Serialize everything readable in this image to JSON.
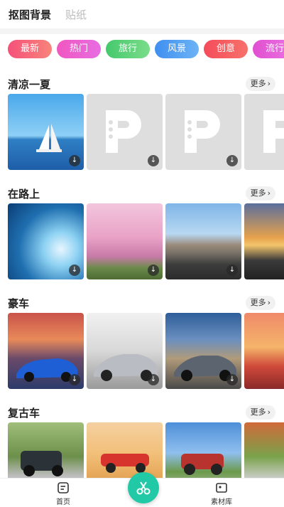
{
  "header": {
    "tabs": [
      {
        "label": "抠图背景",
        "active": true
      },
      {
        "label": "贴纸",
        "active": false
      }
    ]
  },
  "categories": [
    {
      "label": "最新",
      "color": "#f2657c"
    },
    {
      "label": "热门",
      "color": "#e35fd0"
    },
    {
      "label": "旅行",
      "color": "#5fd37a"
    },
    {
      "label": "风景",
      "color": "#4f9ff2"
    },
    {
      "label": "创意",
      "color": "#f45a5a"
    },
    {
      "label": "流行",
      "color": "#e25cd8"
    }
  ],
  "sections": [
    {
      "title": "清凉一夏",
      "more": "更多"
    },
    {
      "title": "在路上",
      "more": "更多"
    },
    {
      "title": "豪车",
      "more": "更多"
    },
    {
      "title": "复古车",
      "more": "更多"
    }
  ],
  "bottom_nav": {
    "home_label": "首页",
    "materials_label": "素材库"
  },
  "icons": {
    "download": "download-icon",
    "more_chevron": "chevron-right-icon",
    "home": "home-icon",
    "scissors": "scissors-icon",
    "materials": "materials-icon"
  }
}
